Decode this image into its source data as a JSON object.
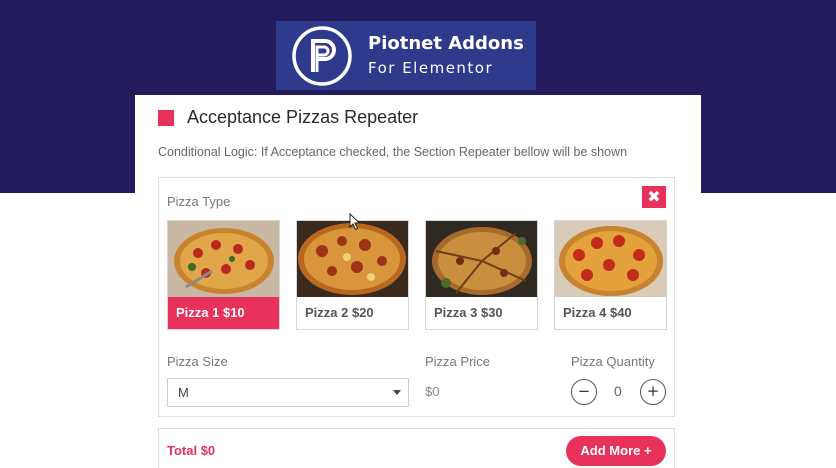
{
  "brand": {
    "title": "Piotnet Addons",
    "subtitle": "For Elementor"
  },
  "section": {
    "title": "Acceptance Pizzas Repeater",
    "note": "Conditional Logic: If Acceptance checked, the Section Repeater bellow will be shown"
  },
  "repeater": {
    "close_icon": "✖",
    "pizza_type_label": "Pizza Type",
    "pizzas": [
      {
        "label": "Pizza 1 $10",
        "selected": true
      },
      {
        "label": "Pizza 2 $20",
        "selected": false
      },
      {
        "label": "Pizza 3 $30",
        "selected": false
      },
      {
        "label": "Pizza 4 $40",
        "selected": false
      }
    ],
    "size_label": "Pizza Size",
    "size_value": "M",
    "price_label": "Pizza Price",
    "price_value": "$0",
    "quantity_label": "Pizza Quantity",
    "quantity_value": "0",
    "minus": "−",
    "plus": "+"
  },
  "footer": {
    "total": "Total $0",
    "add_more": "Add More +"
  },
  "colors": {
    "accent": "#e8315b",
    "hero_bg": "#241b5e",
    "brand_bg": "#2e3a8c"
  }
}
